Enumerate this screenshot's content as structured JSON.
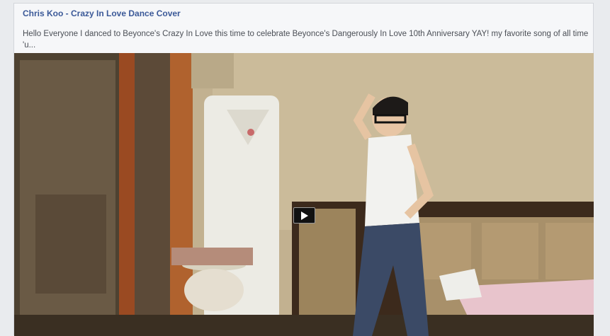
{
  "post": {
    "title": "Chris Koo - Crazy In Love Dance Cover",
    "description": "Hello Everyone I danced to Beyonce's Crazy In Love this time to celebrate Beyonce's Dangerously In Love 10th Anniversary YAY! my favorite song of all time 'u..."
  },
  "video": {
    "play_icon": "play-icon"
  }
}
